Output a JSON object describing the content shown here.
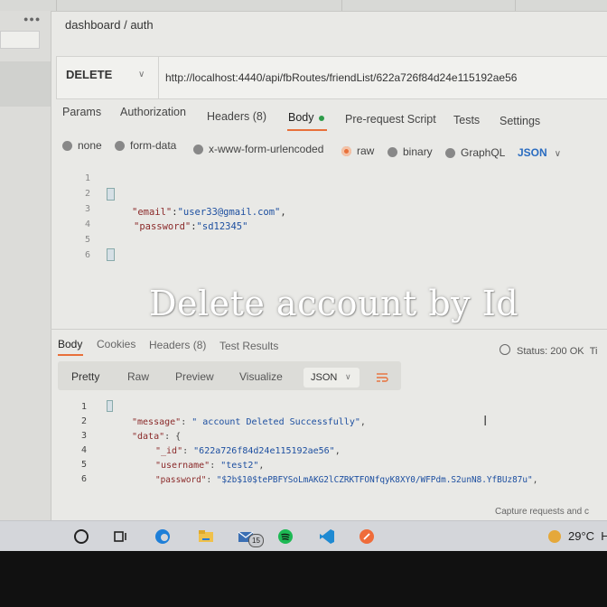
{
  "breadcrumb": {
    "parent": "dashboard",
    "separator": "/",
    "current": "auth"
  },
  "request": {
    "method": "DELETE",
    "url": "http://localhost:4440/api/fbRoutes/friendList/622a726f84d24e115192ae56"
  },
  "request_tabs": [
    {
      "label": "Params"
    },
    {
      "label": "Authorization"
    },
    {
      "label": "Headers (8)"
    },
    {
      "label": "Body"
    },
    {
      "label": "Pre-request Script"
    },
    {
      "label": "Tests"
    },
    {
      "label": "Settings"
    }
  ],
  "body_types": [
    {
      "label": "none"
    },
    {
      "label": "form-data"
    },
    {
      "label": "x-www-form-urlencoded"
    },
    {
      "label": "raw"
    },
    {
      "label": "binary"
    },
    {
      "label": "GraphQL"
    }
  ],
  "body_format": "JSON",
  "request_body": {
    "line_numbers": [
      "1",
      "2",
      "3",
      "4",
      "5",
      "6"
    ],
    "email_key": "\"email\"",
    "email_value": "\"user33@gmail.com\"",
    "password_key": "\"password\"",
    "password_value": "\"sd12345\""
  },
  "caption": "Delete account by Id",
  "response_tabs": [
    {
      "label": "Body"
    },
    {
      "label": "Cookies"
    },
    {
      "label": "Headers (8)"
    },
    {
      "label": "Test Results"
    }
  ],
  "status": "Status: 200 OK",
  "status_more": "Ti",
  "view_tabs": [
    {
      "label": "Pretty"
    },
    {
      "label": "Raw"
    },
    {
      "label": "Preview"
    },
    {
      "label": "Visualize"
    }
  ],
  "response_format": "JSON",
  "response_body": {
    "line_numbers": [
      "1",
      "2",
      "3",
      "4",
      "5",
      "6"
    ],
    "message_key": "\"message\"",
    "message_value": "\" account Deleted Successfully\"",
    "data_key": "\"data\"",
    "id_key": "\"_id\"",
    "id_value": "\"622a726f84d24e115192ae56\"",
    "username_key": "\"username\"",
    "username_value": "\"test2\"",
    "password_key": "\"password\"",
    "password_value": "\"$2b$10$tePBFYSoLmAKG2lCZRKTFONfqyK8XY0/WFPdm.S2unN8.YfBUz87u\""
  },
  "capture_link": "Capture requests and c",
  "taskbar": {
    "badge_count": "15",
    "weather": "29°C",
    "weather_more": "H"
  },
  "colors": {
    "accent_orange": "#e8703a",
    "body_dot_green": "#2e9c4a",
    "json_blue": "#2a6cc0"
  }
}
